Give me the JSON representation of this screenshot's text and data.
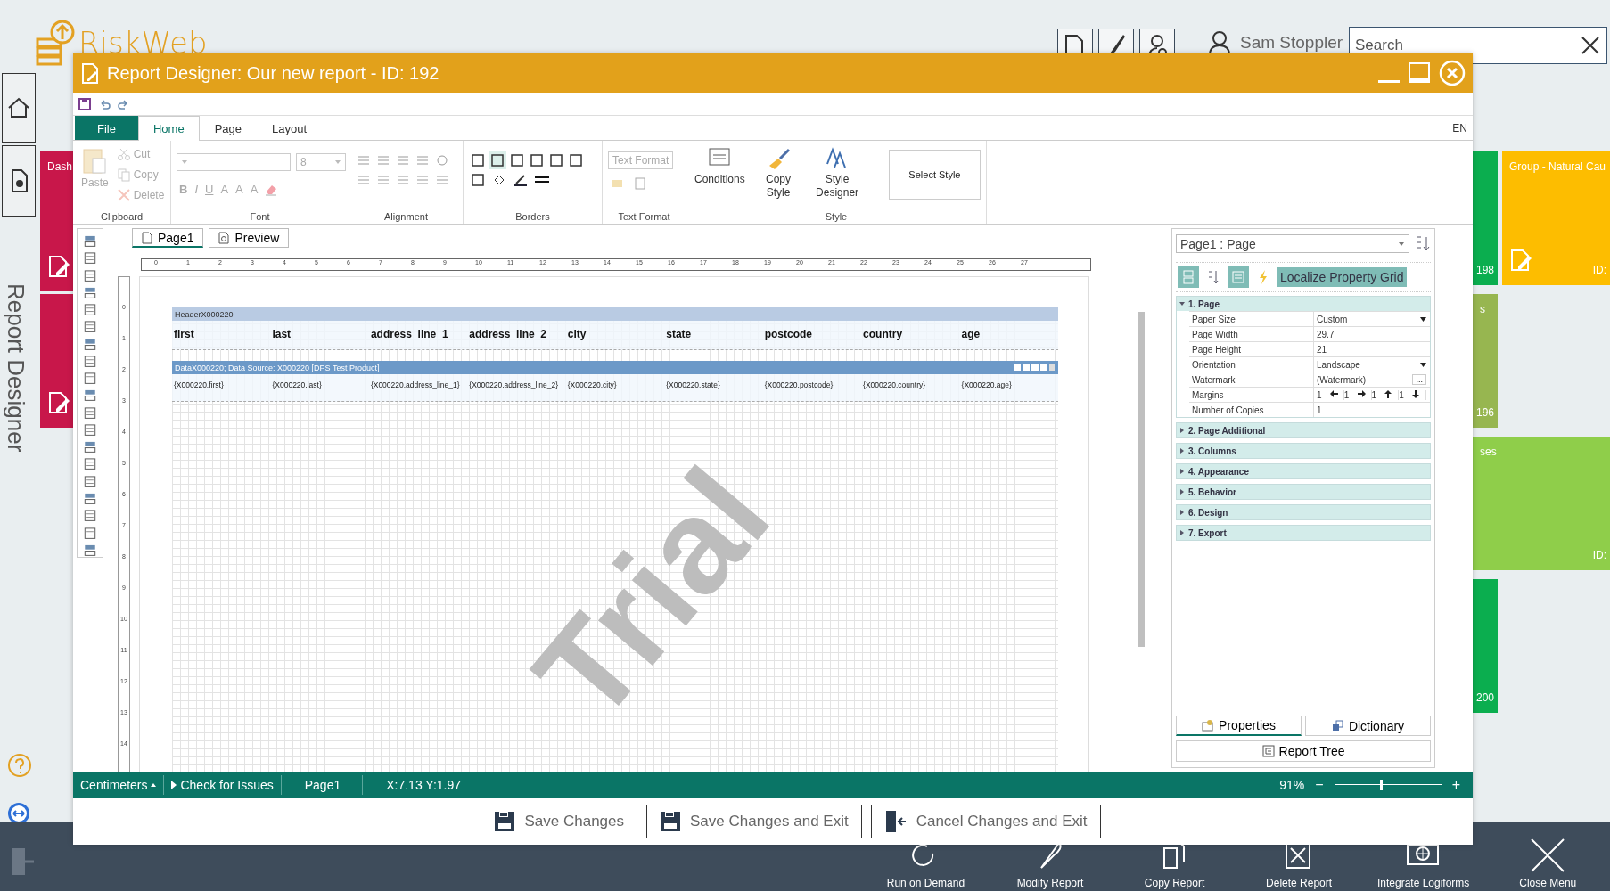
{
  "app": {
    "logo": "RiskWeb",
    "user": "Sam Stoppler",
    "search": {
      "placeholder": "Search"
    },
    "side_label": "Report Designer"
  },
  "tiles": [
    {
      "label": "Dash",
      "color": "#c8174a"
    },
    {
      "color": "#c8174a"
    },
    {
      "number": "198",
      "color": "#0bae4f"
    },
    {
      "label": "Group - Natural Cau",
      "number": "ID:",
      "color": "#fdbd00"
    },
    {
      "label": "s",
      "number": "196",
      "color": "#97b650"
    },
    {
      "label": "ses",
      "number": "ID:",
      "color": "#8fce4a"
    },
    {
      "number": "200",
      "color": "#0bae4f"
    }
  ],
  "bottom_menu": [
    "Run on Demand",
    "Modify Report",
    "Copy Report",
    "Delete Report",
    "Integrate Logiforms",
    "Close Menu"
  ],
  "dialog": {
    "title": "Report Designer: Our new report - ID: 192",
    "ribbon_tabs": [
      {
        "label": "File",
        "kind": "file",
        "selected": false
      },
      {
        "label": "Home",
        "kind": "tab",
        "selected": true
      },
      {
        "label": "Page",
        "kind": "tab",
        "selected": false
      },
      {
        "label": "Layout",
        "kind": "tab",
        "selected": false
      }
    ],
    "language": "EN",
    "ribbon_groups": [
      {
        "label": "Clipboard",
        "kind": "clipboard",
        "items": [
          {
            "label": "Paste",
            "disabled": true
          },
          {
            "label": "Cut",
            "disabled": true
          },
          {
            "label": "Copy",
            "disabled": true
          },
          {
            "label": "Delete",
            "disabled": true
          }
        ]
      },
      {
        "label": "Font",
        "kind": "font",
        "size": "8",
        "buttons": [
          "B",
          "I",
          "U",
          "A",
          "A",
          "A"
        ]
      },
      {
        "label": "Alignment",
        "kind": "alignment"
      },
      {
        "label": "Borders",
        "kind": "borders"
      },
      {
        "label": "Text Format",
        "kind": "textformat",
        "placeholder": "Text Format"
      },
      {
        "label": "Style",
        "kind": "style",
        "items": [
          {
            "label": "Conditions"
          },
          {
            "label": "Copy Style"
          },
          {
            "label": "Style Designer"
          }
        ],
        "select": "Select Style"
      }
    ],
    "designer_tabs": [
      {
        "label": "Page1",
        "selected": true
      },
      {
        "label": "Preview",
        "selected": false
      }
    ],
    "ruler": [
      "0",
      "1",
      "2",
      "3",
      "4",
      "5",
      "6",
      "7",
      "8",
      "9",
      "10",
      "11",
      "12",
      "13",
      "14",
      "15",
      "16",
      "17",
      "18",
      "19",
      "20",
      "21",
      "22",
      "23",
      "24",
      "25",
      "26",
      "27"
    ],
    "vertical_ruler": [
      "0",
      "1",
      "2",
      "3",
      "4",
      "5",
      "6",
      "7",
      "8",
      "9",
      "10",
      "11",
      "12",
      "13",
      "14"
    ],
    "header_band": {
      "title": "HeaderX000220",
      "cells": [
        "first",
        "last",
        "address_line_1",
        "address_line_2",
        "city",
        "state",
        "postcode",
        "country",
        "age"
      ]
    },
    "data_band": {
      "title": "DataX000220; Data Source: X000220 [DPS Test Product]",
      "cells": [
        "{X000220.first}",
        "{X000220.last}",
        "{X000220.address_line_1}",
        "{X000220.address_line_2}",
        "{X000220.city}",
        "{X000220.state}",
        "{X000220.postcode}",
        "{X000220.country}",
        "{X000220.age}"
      ]
    },
    "canvas_watermark": "Trial",
    "properties": {
      "object": "Page1 : Page",
      "localize": "Localize Property Grid",
      "categories": [
        {
          "label": "1. Page",
          "expanded": true,
          "rows": [
            {
              "name": "Paper Size",
              "kind": "dropdown",
              "value": "Custom"
            },
            {
              "name": "Page Width",
              "kind": "text",
              "value": "29.7"
            },
            {
              "name": "Page Height",
              "kind": "text",
              "value": "21"
            },
            {
              "name": "Orientation",
              "kind": "dropdown",
              "value": "Landscape"
            },
            {
              "name": "Watermark",
              "kind": "dialog",
              "value": "(Watermark)",
              "button": "..."
            },
            {
              "name": "Margins",
              "kind": "margins",
              "values": [
                "1",
                "1",
                "1",
                "1"
              ]
            },
            {
              "name": "Number of Copies",
              "kind": "text",
              "value": "1"
            }
          ]
        },
        {
          "label": "2. Page  Additional",
          "expanded": false
        },
        {
          "label": "3. Columns",
          "expanded": false
        },
        {
          "label": "4. Appearance",
          "expanded": false
        },
        {
          "label": "5. Behavior",
          "expanded": false
        },
        {
          "label": "6. Design",
          "expanded": false
        },
        {
          "label": "7. Export",
          "expanded": false
        }
      ],
      "tabs": [
        {
          "label": "Properties",
          "selected": true
        },
        {
          "label": "Dictionary",
          "selected": false
        }
      ],
      "tree_button": "Report Tree"
    },
    "status": {
      "units": "Centimeters",
      "check": "Check for Issues",
      "page": "Page1",
      "coords": "X:7.13  Y:1.97",
      "zoom": "91%",
      "zoom_out": "−",
      "zoom_in": "+",
      "zoom_slider": {
        "level": 0.43
      }
    },
    "buttons": [
      {
        "label": "Save Changes",
        "kind": "save"
      },
      {
        "label": "Save Changes and Exit",
        "kind": "save"
      },
      {
        "label": "Cancel Changes and Exit",
        "kind": "cancel"
      }
    ]
  }
}
